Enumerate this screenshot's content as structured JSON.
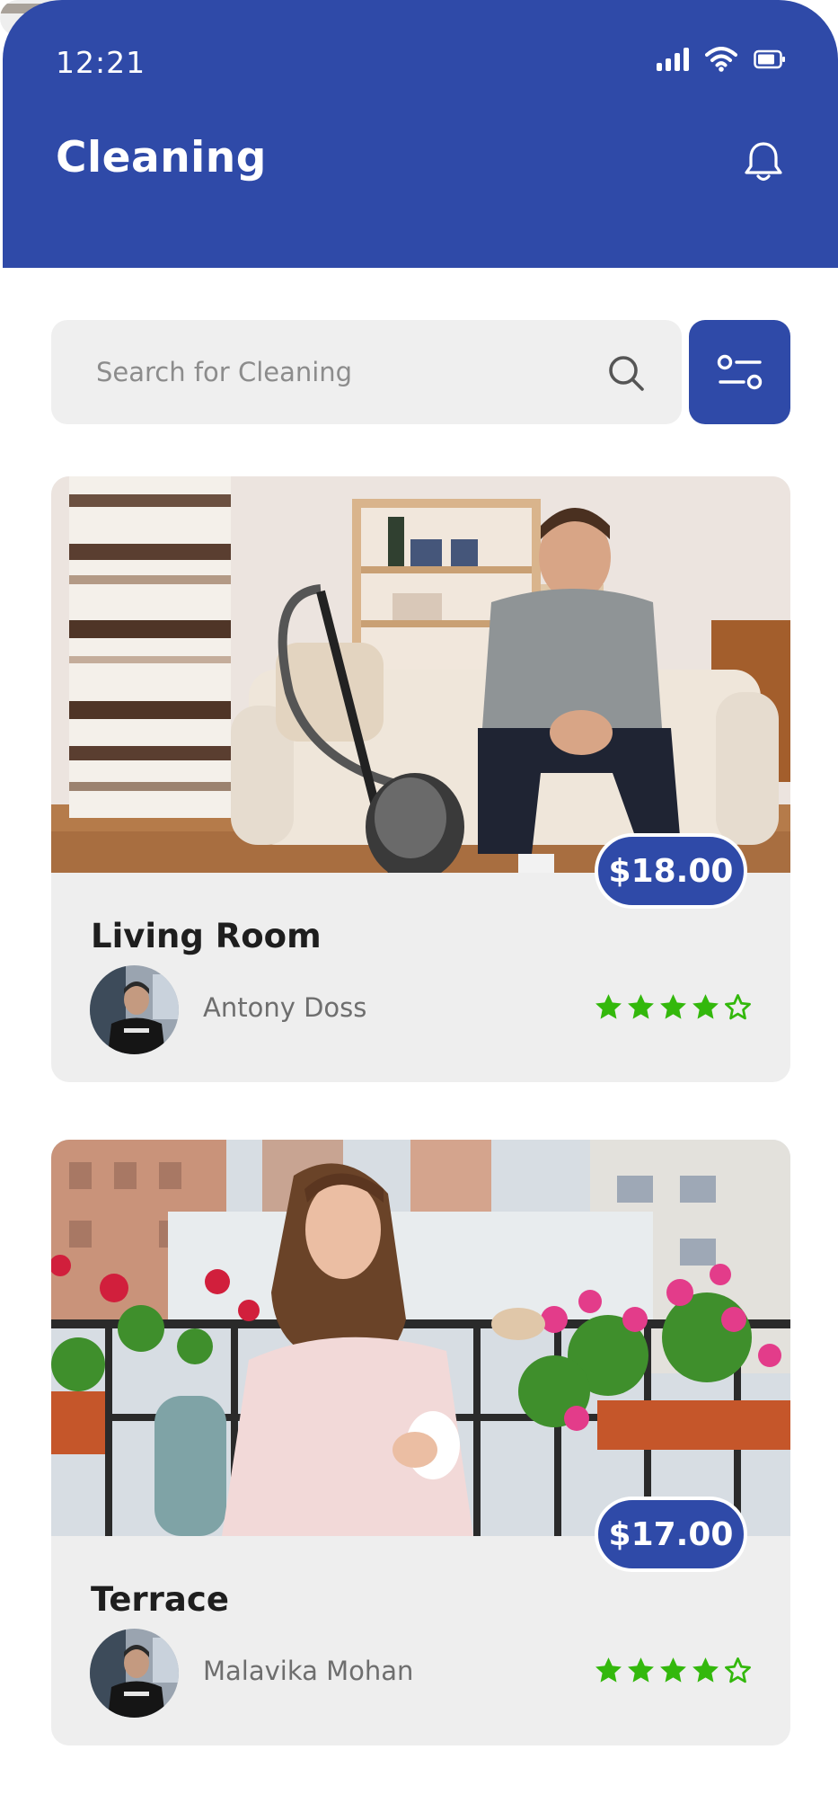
{
  "status_bar": {
    "time": "12:21",
    "icons": [
      "signal-icon",
      "wifi-icon",
      "battery-icon"
    ]
  },
  "header": {
    "title": "Cleaning",
    "notification_icon": "bell-icon"
  },
  "search": {
    "placeholder": "Search for Cleaning",
    "value": "",
    "icon": "search-icon",
    "filter_icon": "filter-icon"
  },
  "cards": [
    {
      "title": "Living Room",
      "price": "$18.00",
      "provider": "Antony Doss",
      "rating": 4,
      "rating_max": 5,
      "image": "man-on-sofa-with-vacuum-photo"
    },
    {
      "title": "Terrace",
      "price": "$17.00",
      "provider": "Malavika Mohan",
      "rating": 4,
      "rating_max": 5,
      "image": "woman-on-balcony-with-flowers-photo"
    }
  ],
  "colors": {
    "brand": "#2f4aa8",
    "star": "#33b80c",
    "card_bg": "#eeeeee",
    "search_bg": "#efefef"
  }
}
